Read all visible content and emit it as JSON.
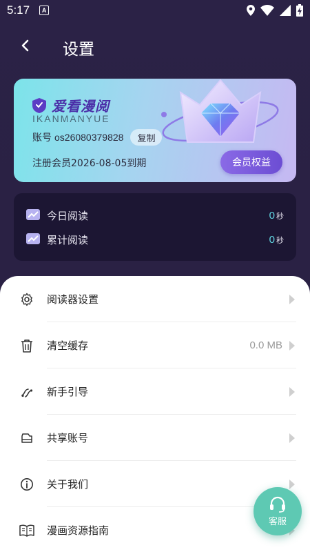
{
  "status_bar": {
    "time": "5:17",
    "notification_letter": "A"
  },
  "header": {
    "title": "设置"
  },
  "member_card": {
    "brand_name": "爱看漫阅",
    "brand_sub": "IKANMANYUE",
    "account_label": "账号",
    "account_value": "os26080379828",
    "copy_label": "复制",
    "expire_text": "注册会员2026-08-05到期",
    "vip_button": "会员权益"
  },
  "stats": {
    "today_label": "今日阅读",
    "today_value": "0",
    "total_label": "累计阅读",
    "total_value": "0",
    "unit": "秒"
  },
  "menu": [
    {
      "label": "阅读器设置",
      "value": "",
      "icon": "gear-icon"
    },
    {
      "label": "清空缓存",
      "value": "0.0 MB",
      "icon": "trash-icon"
    },
    {
      "label": "新手引导",
      "value": "",
      "icon": "guide-icon"
    },
    {
      "label": "共享账号",
      "value": "",
      "icon": "share-account-icon"
    },
    {
      "label": "关于我们",
      "value": "",
      "icon": "info-icon"
    },
    {
      "label": "漫画资源指南",
      "value": "",
      "icon": "book-icon"
    }
  ],
  "service_fab": {
    "label": "客服"
  },
  "colors": {
    "background": "#2b2246",
    "accent_cyan": "#62d8e4",
    "vip_purple": "#7a5ce0",
    "fab_green": "#5ec9b3"
  }
}
